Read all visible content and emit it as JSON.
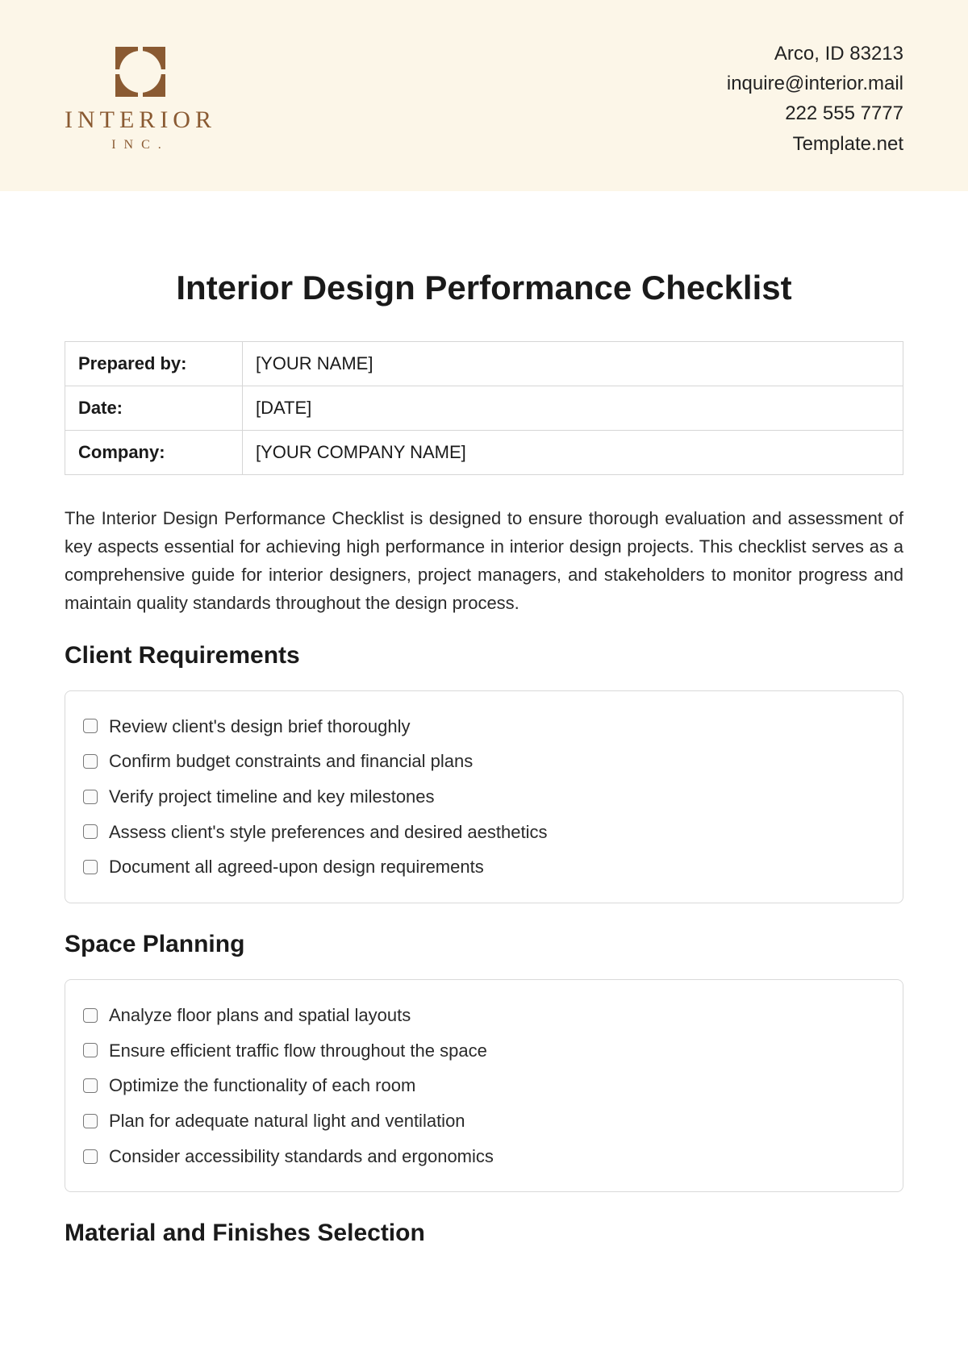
{
  "header": {
    "logo_word": "INTERIOR",
    "logo_sub": "INC.",
    "contact": {
      "address": "Arco, ID 83213",
      "email": "inquire@interior.mail",
      "phone": "222 555 7777",
      "site": "Template.net"
    }
  },
  "title": "Interior Design Performance Checklist",
  "meta": {
    "rows": [
      {
        "key": "Prepared by:",
        "value": "[YOUR NAME]"
      },
      {
        "key": "Date:",
        "value": "[DATE]"
      },
      {
        "key": "Company:",
        "value": "[YOUR COMPANY NAME]"
      }
    ]
  },
  "intro": "The Interior Design Performance Checklist is designed to ensure thorough evaluation and assessment of key aspects essential for achieving high performance in interior design projects. This checklist serves as a comprehensive guide for interior designers, project managers, and stakeholders to monitor progress and maintain quality standards throughout the design process.",
  "sections": [
    {
      "heading": "Client Requirements",
      "items": [
        "Review client's design brief thoroughly",
        "Confirm budget constraints and financial plans",
        "Verify project timeline and key milestones",
        "Assess client's style preferences and desired aesthetics",
        "Document all agreed-upon design requirements"
      ]
    },
    {
      "heading": "Space Planning",
      "items": [
        "Analyze floor plans and spatial layouts",
        "Ensure efficient traffic flow throughout the space",
        "Optimize the functionality of each room",
        "Plan for adequate natural light and ventilation",
        "Consider accessibility standards and ergonomics"
      ]
    },
    {
      "heading": "Material and Finishes Selection",
      "items": []
    }
  ]
}
